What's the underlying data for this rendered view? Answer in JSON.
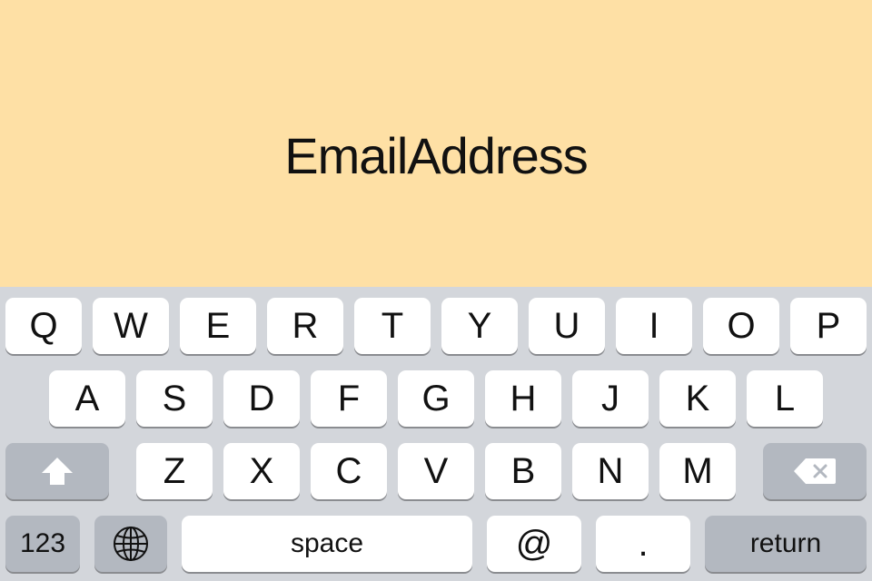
{
  "field": {
    "text": "EmailAddress"
  },
  "colors": {
    "field_background": "#fee0a5",
    "keyboard_background": "#d3d6db",
    "key_light": "#ffffff",
    "key_dark": "#b3b8c0"
  },
  "keyboard": {
    "row1": [
      "Q",
      "W",
      "E",
      "R",
      "T",
      "Y",
      "U",
      "I",
      "O",
      "P"
    ],
    "row2": [
      "A",
      "S",
      "D",
      "F",
      "G",
      "H",
      "J",
      "K",
      "L"
    ],
    "row3": [
      "Z",
      "X",
      "C",
      "V",
      "B",
      "N",
      "M"
    ],
    "numbers_label": "123",
    "space_label": "space",
    "at_label": "@",
    "dot_label": ".",
    "return_label": "return",
    "shift_icon": "shift-arrow-icon",
    "delete_icon": "backspace-icon",
    "globe_icon": "globe-icon"
  }
}
